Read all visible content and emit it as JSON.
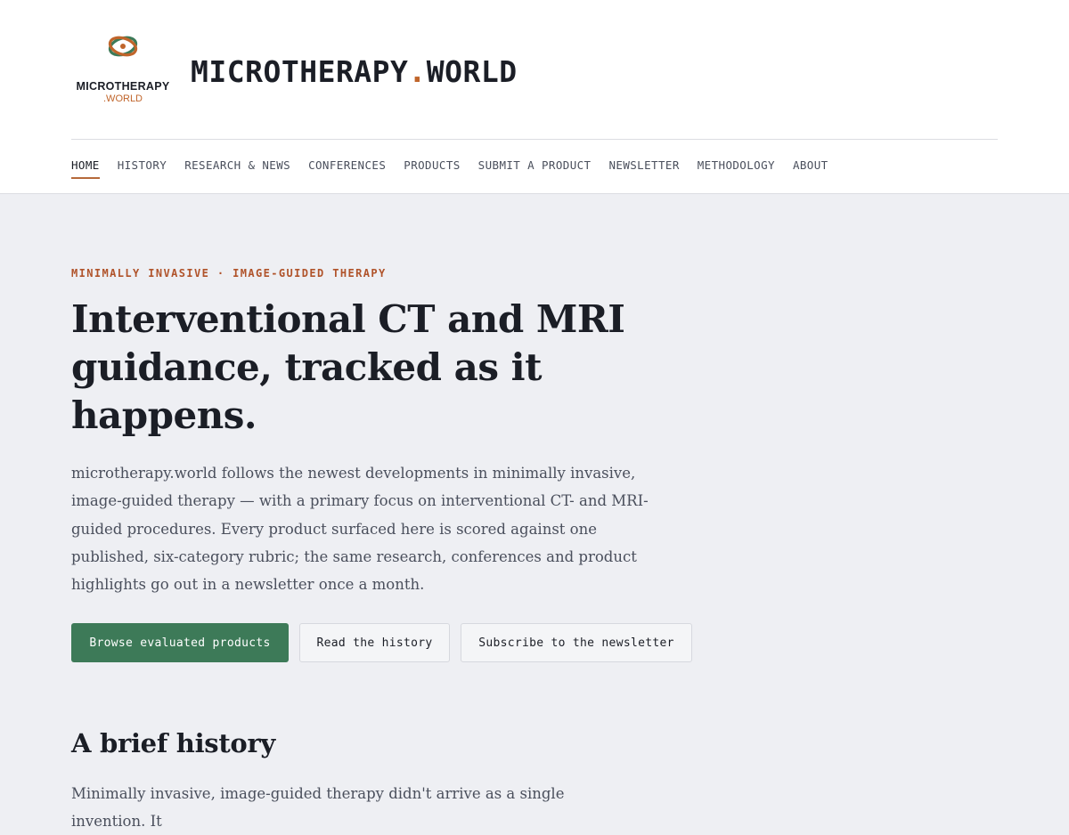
{
  "brand": {
    "logo_name": "MICROTHERAPY",
    "logo_tld": ".WORLD",
    "wordmark_main": "MICROTHERAPY",
    "wordmark_dot": ".",
    "wordmark_tld": "WORLD",
    "accent_color": "#c0652b",
    "logo_icon": "orbit-logo-icon"
  },
  "nav": {
    "items": [
      {
        "label": "HOME",
        "active": true
      },
      {
        "label": "HISTORY"
      },
      {
        "label": "RESEARCH & NEWS"
      },
      {
        "label": "CONFERENCES"
      },
      {
        "label": "PRODUCTS"
      },
      {
        "label": "SUBMIT A PRODUCT"
      },
      {
        "label": "NEWSLETTER"
      },
      {
        "label": "METHODOLOGY"
      },
      {
        "label": "ABOUT"
      }
    ]
  },
  "hero": {
    "eyebrow": "MINIMALLY INVASIVE · IMAGE-GUIDED THERAPY",
    "title": "Interventional CT and MRI guidance, tracked as it happens.",
    "description": "microtherapy.world follows the newest developments in minimally invasive, image-guided therapy — with a primary focus on interventional CT- and MRI-guided procedures. Every product surfaced here is scored against one published, six-category rubric; the same research, conferences and product highlights go out in a newsletter once a month.",
    "cta_primary": "Browse evaluated products",
    "cta_history": "Read the history",
    "cta_newsletter": "Subscribe to the newsletter",
    "primary_color": "#3d7a58"
  },
  "history": {
    "title": "A brief history",
    "text": "Minimally invasive, image-guided therapy didn't arrive as a single invention. It"
  }
}
